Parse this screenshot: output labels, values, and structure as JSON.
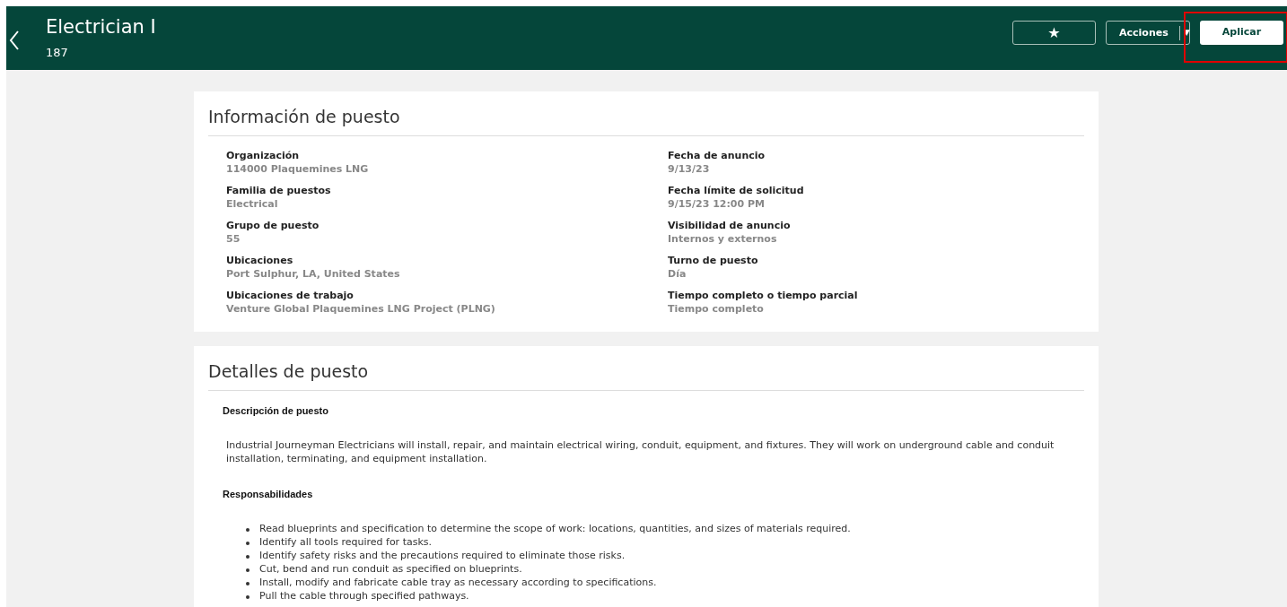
{
  "header": {
    "title": "Electrician I",
    "subtitle": "187",
    "favorite_button": {
      "label": "★"
    },
    "actions_button": {
      "label": "Acciones",
      "caret": "▼"
    },
    "apply_button": {
      "label": "Aplicar",
      "highlighted": true
    }
  },
  "job_info": {
    "title": "Información de puesto",
    "left_fields": [
      {
        "label": "Organización",
        "value": "114000 Plaquemines LNG"
      },
      {
        "label": "Familia de puestos",
        "value": "Electrical"
      },
      {
        "label": "Grupo de puesto",
        "value": "55"
      },
      {
        "label": "Ubicaciones",
        "value": "Port Sulphur, LA, United States"
      },
      {
        "label": "Ubicaciones de trabajo",
        "value": "Venture Global Plaquemines LNG Project (PLNG)"
      }
    ],
    "right_fields": [
      {
        "label": "Fecha de anuncio",
        "value": "9/13/23"
      },
      {
        "label": "Fecha límite de solicitud",
        "value": "9/15/23 12:00 PM"
      },
      {
        "label": "Visibilidad de anuncio",
        "value": "Internos y externos"
      },
      {
        "label": "Turno de puesto",
        "value": "Día"
      },
      {
        "label": "Tiempo completo o tiempo parcial",
        "value": "Tiempo completo"
      }
    ]
  },
  "job_details": {
    "title": "Detalles de puesto",
    "description_heading": "Descripción de puesto",
    "description": "Industrial Journeyman Electricians will install, repair, and maintain electrical wiring, conduit, equipment, and fixtures. They will work on underground cable and conduit installation, terminating, and equipment installation.",
    "responsibilities_heading": "Responsabilidades",
    "responsibilities": [
      "Read blueprints and specification to determine the scope of work: locations, quantities, and sizes of materials required.",
      "Identify all tools required for tasks.",
      "Identify safety risks and the precautions required to eliminate those risks.",
      "Cut, bend and run conduit as specified on blueprints.",
      "Install, modify and fabricate cable tray as necessary according to specifications.",
      "Pull the cable through specified pathways."
    ]
  }
}
